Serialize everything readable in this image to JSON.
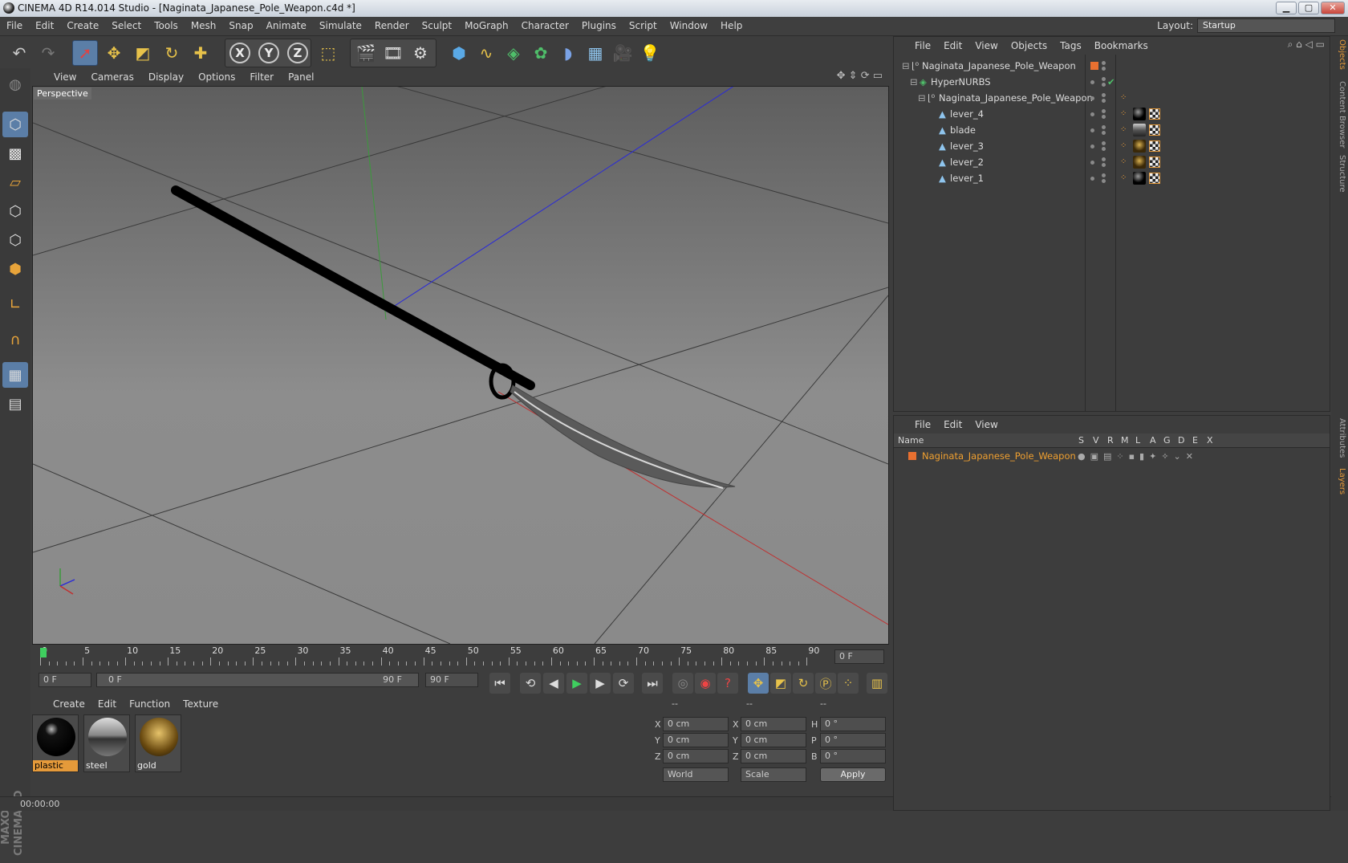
{
  "window": {
    "title": "CINEMA 4D R14.014 Studio - [Naginata_Japanese_Pole_Weapon.c4d *]",
    "min": "▁",
    "max": "▢",
    "close": "✕"
  },
  "menubar": {
    "items": [
      "File",
      "Edit",
      "Create",
      "Select",
      "Tools",
      "Mesh",
      "Snap",
      "Animate",
      "Simulate",
      "Render",
      "Sculpt",
      "MoGraph",
      "Character",
      "Plugins",
      "Script",
      "Window",
      "Help"
    ],
    "layout_label": "Layout:",
    "layout_value": "Startup"
  },
  "viewport": {
    "menu": [
      "View",
      "Cameras",
      "Display",
      "Options",
      "Filter",
      "Panel"
    ],
    "label": "Perspective"
  },
  "timeline": {
    "ticks": [
      "0",
      "5",
      "10",
      "15",
      "20",
      "25",
      "30",
      "35",
      "40",
      "45",
      "50",
      "55",
      "60",
      "65",
      "70",
      "75",
      "80",
      "85",
      "90"
    ],
    "frame_field": "0 F"
  },
  "transport": {
    "start": "0 F",
    "range_start": "0 F",
    "range_end": "90 F",
    "end": "90 F"
  },
  "materials": {
    "menu": [
      "Create",
      "Edit",
      "Function",
      "Texture"
    ],
    "items": [
      {
        "name": "plastic"
      },
      {
        "name": "steel"
      },
      {
        "name": "gold"
      }
    ]
  },
  "coords": {
    "headers": [
      "--",
      "--",
      "--"
    ],
    "rows": [
      {
        "a": "X",
        "av": "0 cm",
        "b": "X",
        "bv": "0 cm",
        "c": "H",
        "cv": "0 °"
      },
      {
        "a": "Y",
        "av": "0 cm",
        "b": "Y",
        "bv": "0 cm",
        "c": "P",
        "cv": "0 °"
      },
      {
        "a": "Z",
        "av": "0 cm",
        "b": "Z",
        "bv": "0 cm",
        "c": "B",
        "cv": "0 °"
      }
    ],
    "world": "World",
    "scale": "Scale",
    "apply": "Apply"
  },
  "status": {
    "time": "00:00:00"
  },
  "objects": {
    "menu": [
      "File",
      "Edit",
      "View",
      "Objects",
      "Tags",
      "Bookmarks"
    ],
    "tree": [
      {
        "name": "Naginata_Japanese_Pole_Weapon"
      },
      {
        "name": "HyperNURBS"
      },
      {
        "name": "Naginata_Japanese_Pole_Weapon"
      },
      {
        "name": "lever_4"
      },
      {
        "name": "blade"
      },
      {
        "name": "lever_3"
      },
      {
        "name": "lever_2"
      },
      {
        "name": "lever_1"
      }
    ]
  },
  "layers": {
    "menu": [
      "File",
      "Edit",
      "View"
    ],
    "columns": {
      "name": "Name",
      "flags": [
        "S",
        "V",
        "R",
        "M",
        "L",
        "A",
        "G",
        "D",
        "E",
        "X"
      ]
    },
    "rows": [
      {
        "name": "Naginata_Japanese_Pole_Weapon"
      }
    ]
  },
  "sidetabs": [
    "Objects",
    "Content Browser",
    "Structure",
    "Attributes",
    "Layers"
  ],
  "colors": {
    "accent": "#e59a3a",
    "selection": "#5b7ea7",
    "viewport_top": "#5e5e5e",
    "viewport_bottom": "#8d8d8d"
  }
}
